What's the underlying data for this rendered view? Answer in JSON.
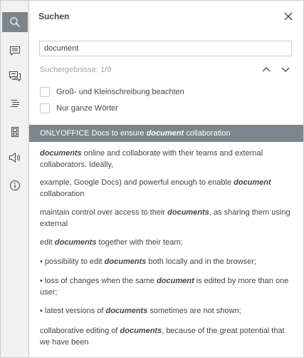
{
  "panel": {
    "title": "Suchen",
    "search_value": "document",
    "results_count": "Suchergebnisse: 1/9",
    "options": {
      "match_case": "Groß- und Kleinschreibung beachten",
      "whole_words": "Nur ganze Wörter"
    }
  },
  "leftbar": {
    "icons": [
      "search-icon",
      "comment-icon",
      "chat-icon",
      "navigation-icon",
      "page-thumbnails-icon",
      "feedback-icon",
      "about-icon"
    ],
    "active": "search-icon"
  },
  "colors": {
    "selected_bg": "#7d858c",
    "text": "#444444",
    "muted": "#a5a5a5"
  },
  "results": [
    {
      "pre": "ONLYOFFICE Docs to ensure ",
      "match": "document",
      "post": " collaboration"
    },
    {
      "pre": "",
      "match": "documents",
      "post": " online and collaborate with their teams and external collaborators. Ideally,"
    },
    {
      "pre": "example, Google Docs) and powerful enough to enable ",
      "match": "document",
      "post": " collaboration"
    },
    {
      "pre": "maintain control over access to their ",
      "match": "documents",
      "post": ", as sharing them using external"
    },
    {
      "pre": "edit ",
      "match": "documents",
      "post": " together with their team;"
    },
    {
      "pre": "• possibility to edit ",
      "match": "documents",
      "post": " both locally and in the browser;"
    },
    {
      "pre": "• loss of changes when the same ",
      "match": "document",
      "post": " is edited by more than one user;"
    },
    {
      "pre": "• latest versions of ",
      "match": "documents",
      "post": " sometimes are not shown;"
    },
    {
      "pre": "collaborative editing of ",
      "match": "documents",
      "post": ", because of the great potential that we have been"
    }
  ]
}
